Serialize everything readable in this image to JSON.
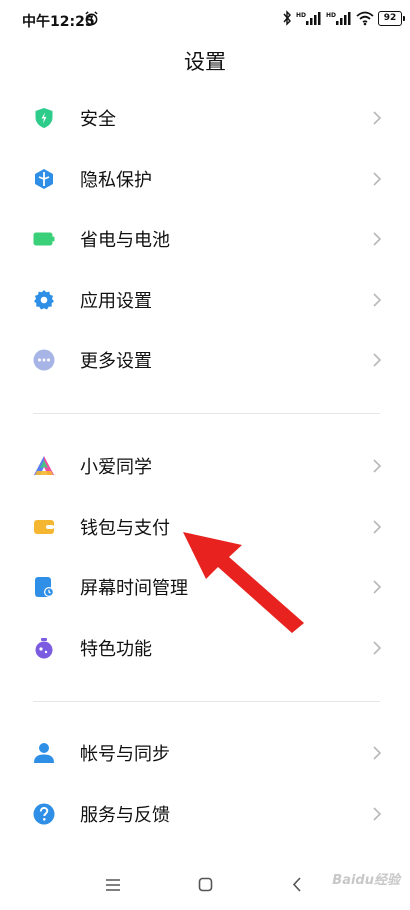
{
  "status_bar": {
    "time": "中午12:25",
    "battery": "92",
    "icons": [
      "alarm-icon",
      "bluetooth-icon",
      "signal-hd-icon",
      "signal-hd-icon",
      "wifi-icon",
      "battery-icon"
    ]
  },
  "header": {
    "title": "设置"
  },
  "groups": [
    {
      "items": [
        {
          "label": "安全",
          "icon": "shield-icon",
          "color": "#2ecc8a"
        },
        {
          "label": "隐私保护",
          "icon": "privacy-icon",
          "color": "#2f8fe6"
        },
        {
          "label": "省电与电池",
          "icon": "battery-saver-icon",
          "color": "#3ad07a"
        },
        {
          "label": "应用设置",
          "icon": "gear-icon",
          "color": "#2f8fe6"
        },
        {
          "label": "更多设置",
          "icon": "more-dots-icon",
          "color": "#9aaae0"
        }
      ]
    },
    {
      "items": [
        {
          "label": "小爱同学",
          "icon": "xiaoai-icon",
          "color": "#5b7bf0"
        },
        {
          "label": "钱包与支付",
          "icon": "wallet-icon",
          "color": "#f5b731"
        },
        {
          "label": "屏幕时间管理",
          "icon": "screen-time-icon",
          "color": "#2f8fe6"
        },
        {
          "label": "特色功能",
          "icon": "flask-icon",
          "color": "#7b5ce0"
        }
      ]
    },
    {
      "items": [
        {
          "label": "帐号与同步",
          "icon": "account-icon",
          "color": "#2f8fe6"
        },
        {
          "label": "服务与反馈",
          "icon": "help-icon",
          "color": "#2f8fe6"
        }
      ]
    }
  ],
  "nav_bar": {
    "icons": [
      "menu-icon",
      "home-icon",
      "back-icon"
    ]
  },
  "watermark": "Baidu经验"
}
